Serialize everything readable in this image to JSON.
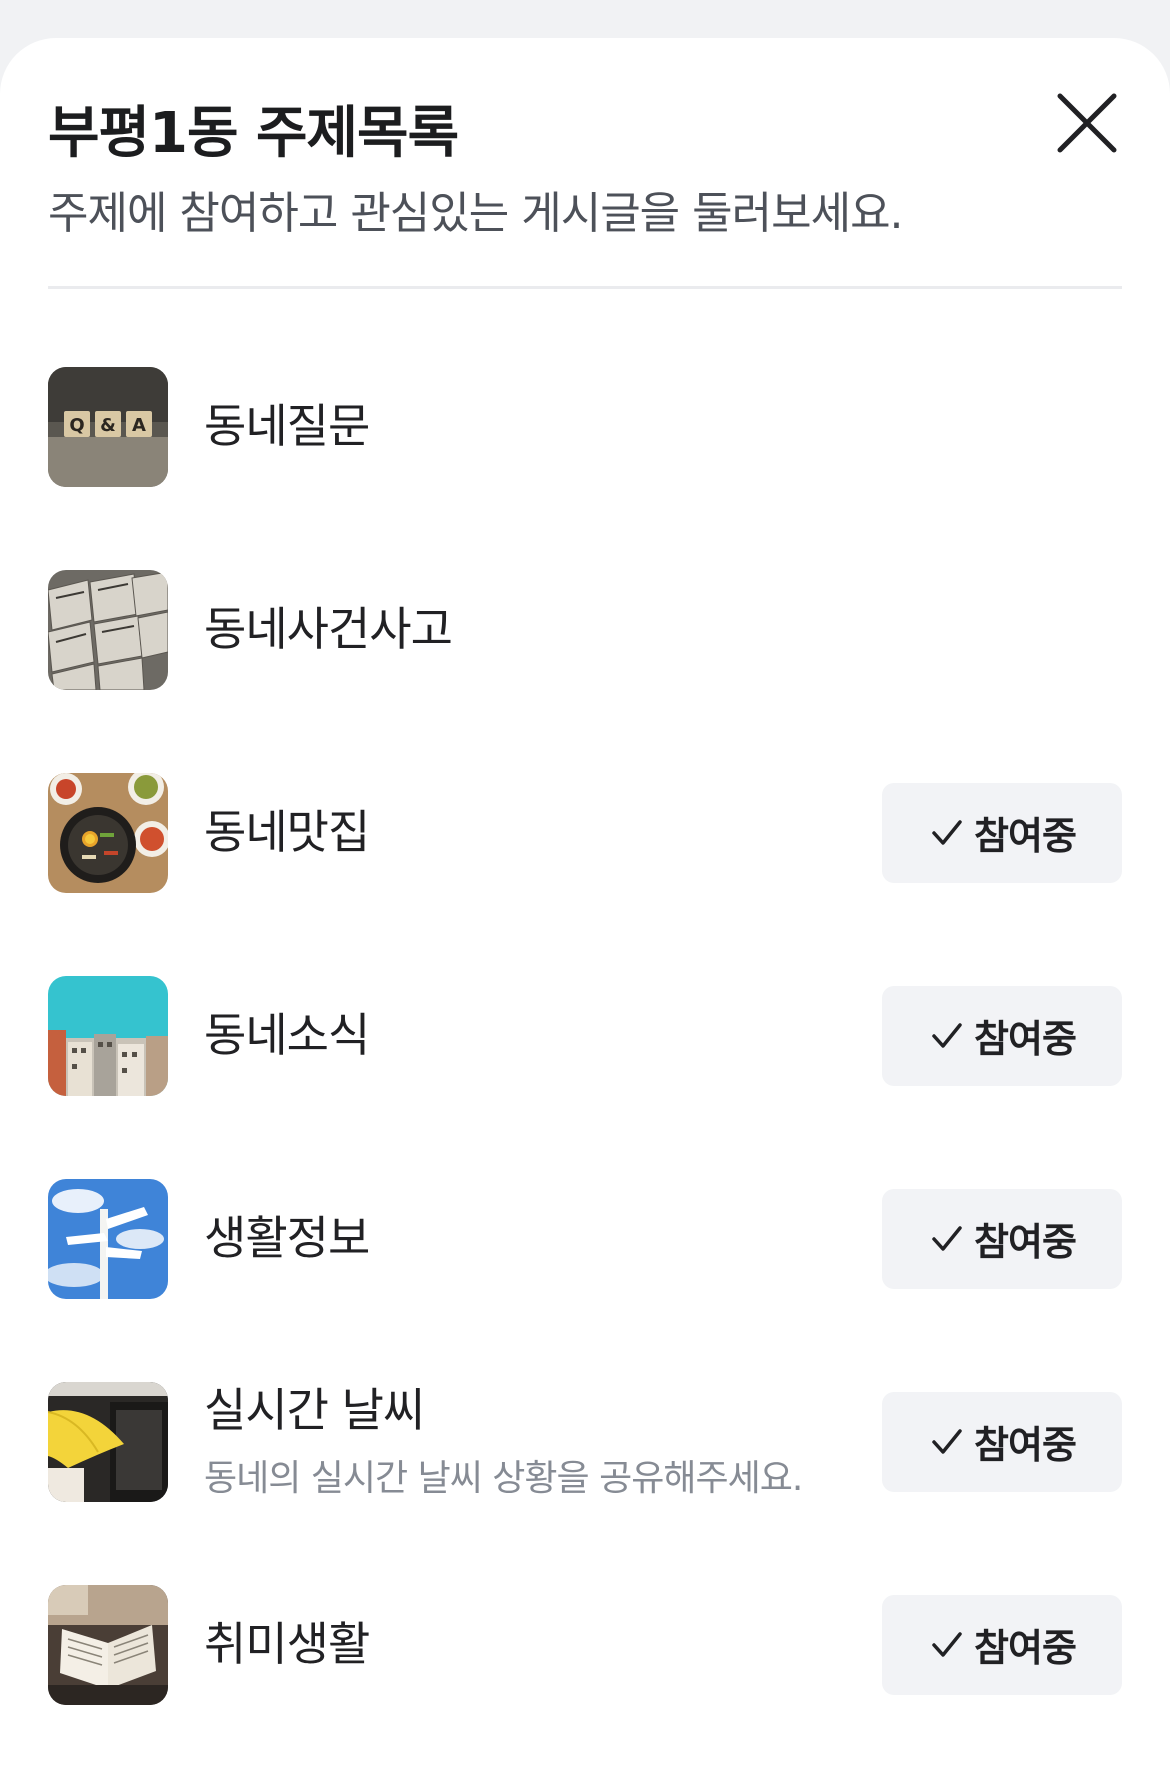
{
  "header": {
    "title": "부평1동 주제목록",
    "subtitle": "주제에 참여하고 관심있는 게시글을 둘러보세요.",
    "close_icon": "close-icon"
  },
  "topics": [
    {
      "name": "동네질문",
      "description": "",
      "joined": false,
      "button_label": "",
      "thumb": "qa-blocks"
    },
    {
      "name": "동네사건사고",
      "description": "",
      "joined": false,
      "button_label": "",
      "thumb": "newspapers"
    },
    {
      "name": "동네맛집",
      "description": "",
      "joined": true,
      "button_label": "참여중",
      "thumb": "korean-food"
    },
    {
      "name": "동네소식",
      "description": "",
      "joined": true,
      "button_label": "참여중",
      "thumb": "city-skyline"
    },
    {
      "name": "생활정보",
      "description": "",
      "joined": true,
      "button_label": "참여중",
      "thumb": "signpost-sky"
    },
    {
      "name": "실시간 날씨",
      "description": "동네의 실시간 날씨 상황을 공유해주세요.",
      "joined": true,
      "button_label": "참여중",
      "thumb": "yellow-umbrella"
    },
    {
      "name": "취미생활",
      "description": "",
      "joined": true,
      "button_label": "참여중",
      "thumb": "reading-book"
    }
  ],
  "colors": {
    "background": "#ffffff",
    "button_bg": "#f2f3f6",
    "text_primary": "#212124",
    "text_secondary": "#868b94"
  }
}
